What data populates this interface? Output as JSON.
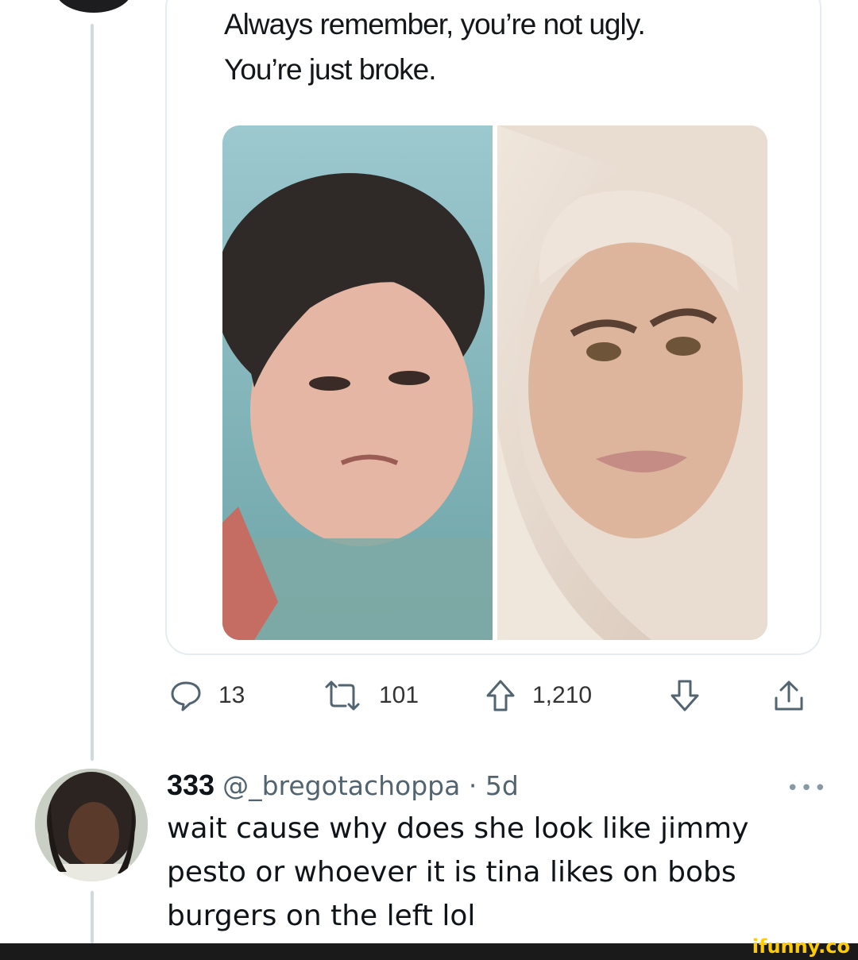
{
  "quoted_tweet": {
    "lines": [
      "Always remember, you’re not ugly.",
      "You’re just broke."
    ]
  },
  "actions": {
    "reply_count": "13",
    "retweet_count": "101",
    "upvote_count": "1,210"
  },
  "reply": {
    "display_name": "333",
    "handle": "@_bregotachoppa",
    "separator": " · ",
    "time": "5d",
    "more": "•••",
    "body_lines": [
      "wait cause why does she look like jimmy",
      "pesto or whoever it is tina likes on bobs",
      "burgers on the left lol"
    ]
  },
  "footer": {
    "brand": "ifunny.co"
  },
  "colors": {
    "thread_line": "#cfd9de",
    "icon_gray": "#536471",
    "brand_yellow": "#ffcc00"
  }
}
